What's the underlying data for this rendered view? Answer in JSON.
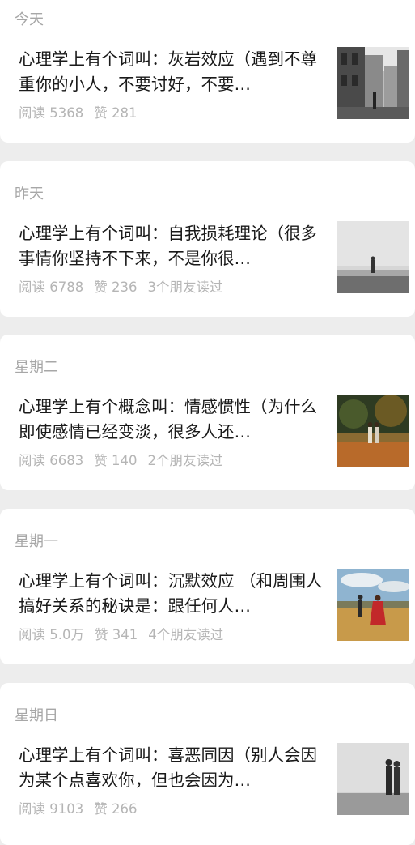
{
  "articles": [
    {
      "day": "今天",
      "title": "心理学上有个词叫：灰岩效应（遇到不尊重你的小人，不要讨好，不要…",
      "read": "阅读 5368",
      "like": "赞 281",
      "friends": "",
      "thumb_icon": "street-photo-icon"
    },
    {
      "day": "昨天",
      "title": "心理学上有个词叫：自我损耗理论（很多事情你坚持不下来，不是你很…",
      "read": "阅读 6788",
      "like": "赞 236",
      "friends": "3个朋友读过",
      "thumb_icon": "foggy-figure-photo-icon"
    },
    {
      "day": "星期二",
      "title": "心理学上有个概念叫：情感惯性（为什么即使感情已经变淡，很多人还…",
      "read": "阅读 6683",
      "like": "赞 140",
      "friends": "2个朋友读过",
      "thumb_icon": "couple-autumn-photo-icon"
    },
    {
      "day": "星期一",
      "title": "心理学上有个词叫：沉默效应 （和周围人搞好关系的秘诀是：跟任何人…",
      "read": "阅读 5.0万",
      "like": "赞 341",
      "friends": "4个朋友读过",
      "thumb_icon": "couple-field-photo-icon"
    },
    {
      "day": "星期日",
      "title": "心理学上有个词叫：喜恶同因（别人会因为某个点喜欢你，但也会因为…",
      "read": "阅读 9103",
      "like": "赞 266",
      "friends": "",
      "thumb_icon": "couple-mist-photo-icon"
    }
  ]
}
